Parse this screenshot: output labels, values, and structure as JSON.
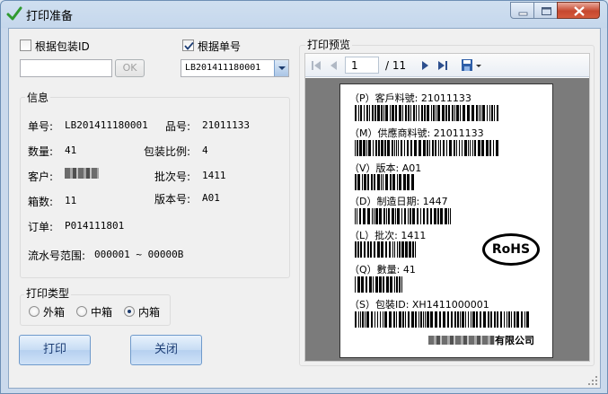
{
  "window": {
    "title": "打印准备",
    "controls": [
      "minimize-icon",
      "maximize-icon",
      "close-icon"
    ]
  },
  "search": {
    "by_package_id_label": "根据包装ID",
    "by_package_id_checked": false,
    "package_id_value": "",
    "ok_label": "OK",
    "by_order_label": "根据单号",
    "by_order_checked": true,
    "order_value": "LB201411180001"
  },
  "info": {
    "title": "信息",
    "order_no_label": "单号:",
    "order_no": "LB201411180001",
    "part_no_label": "品号:",
    "part_no": "21011133",
    "quantity_label": "数量:",
    "quantity": "41",
    "pack_ratio_label": "包装比例:",
    "pack_ratio": "4",
    "customer_label": "客户:",
    "batch_label": "批次号:",
    "batch": "1411",
    "box_count_label": "箱数:",
    "box_count": "11",
    "version_label": "版本号:",
    "version": "A01",
    "po_label": "订单:",
    "po": "P014111801",
    "serial_range_label": "流水号范围:",
    "serial_range": "000001 ~ 00000B"
  },
  "print_type": {
    "title": "打印类型",
    "options": [
      "外箱",
      "中箱",
      "内箱"
    ],
    "selected": "内箱"
  },
  "buttons": {
    "print": "打印",
    "close": "关闭"
  },
  "preview": {
    "title": "打印预览",
    "page": "1",
    "page_total": "/ 11",
    "toolbar_icons": [
      "first-page-icon",
      "prev-page-icon",
      "next-page-icon",
      "last-page-icon",
      "export-icon"
    ],
    "label": {
      "customer_part": "（P）客戶料號: 21011133",
      "vendor_part": "（M）供應商料號: 21011133",
      "version": "（V）版本: A01",
      "date_code": "（D）制造日期: 1447",
      "lot": "（L）批次: 1411",
      "quantity": "（Q）數量: 41",
      "package_id": "（S）包裝ID: XH1411000001",
      "rohs": "RoHS",
      "company_suffix": "有限公司"
    }
  }
}
